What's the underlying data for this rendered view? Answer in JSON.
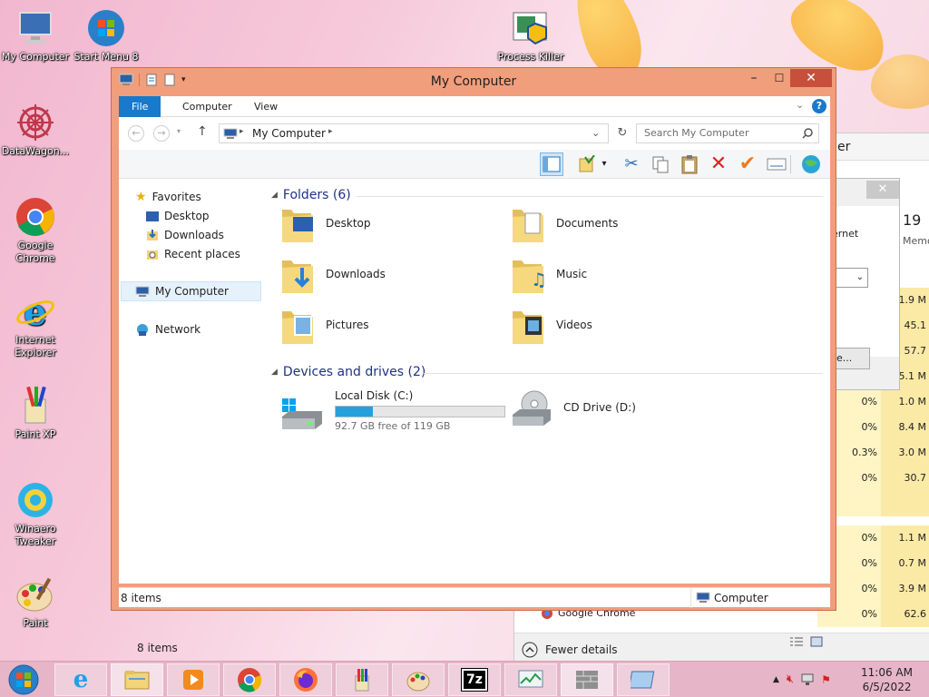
{
  "desktop": {
    "icons": [
      {
        "label": "My Computer"
      },
      {
        "label": "Start Menu 8"
      },
      {
        "label": "Process Killer"
      },
      {
        "label": "DataWagon..."
      },
      {
        "label": "Google Chrome"
      },
      {
        "label": "Internet Explorer"
      },
      {
        "label": "Paint XP"
      },
      {
        "label": "Winaero Tweaker"
      },
      {
        "label": "Paint"
      }
    ]
  },
  "task_manager": {
    "header_count": "19",
    "header_label": "Memo",
    "partial_title": "er",
    "dialog_text": "ernet",
    "dialog_button": "e...",
    "rows": [
      {
        "cpu": "",
        "mem": "1.9 M"
      },
      {
        "cpu": "",
        "mem": "45.1"
      },
      {
        "cpu": "",
        "mem": "57.7"
      },
      {
        "cpu": "",
        "mem": "5.1 M"
      },
      {
        "cpu": "0%",
        "mem": "1.0 M"
      },
      {
        "cpu": "0%",
        "mem": "8.4 M"
      },
      {
        "cpu": "0.3%",
        "mem": "3.0 M"
      },
      {
        "cpu": "0%",
        "mem": "30.7"
      },
      {
        "cpu": "",
        "mem": ""
      },
      {
        "cpu": "0%",
        "mem": "1.1 M"
      },
      {
        "cpu": "0%",
        "mem": "0.7 M"
      },
      {
        "cpu": "0%",
        "mem": "3.9 M"
      },
      {
        "cpu": "0%",
        "mem": "62.6"
      }
    ],
    "chrome_row": "Google Chrome",
    "fewer_details": "Fewer details"
  },
  "explorer": {
    "title": "My Computer",
    "tabs": {
      "file": "File",
      "computer": "Computer",
      "view": "View"
    },
    "address": "My Computer",
    "search_placeholder": "Search My Computer",
    "nav": {
      "favorites": "Favorites",
      "desktop": "Desktop",
      "downloads": "Downloads",
      "recent": "Recent places",
      "computer": "My Computer",
      "network": "Network"
    },
    "folders_header": "Folders (6)",
    "folders": [
      {
        "name": "Desktop"
      },
      {
        "name": "Documents"
      },
      {
        "name": "Downloads"
      },
      {
        "name": "Music"
      },
      {
        "name": "Pictures"
      },
      {
        "name": "Videos"
      }
    ],
    "drives_header": "Devices and drives (2)",
    "drives": {
      "local": {
        "name": "Local Disk (C:)",
        "free": "92.7 GB free of 119 GB",
        "used_fraction": 0.221
      },
      "cd": {
        "name": "CD Drive (D:)"
      }
    },
    "items_count": "8 items",
    "status_left": "8 items",
    "status_right": "Computer"
  },
  "taskbar": {
    "time": "11:06 AM",
    "date": "6/5/2022"
  },
  "colors": {
    "accent": "#1979ca",
    "window_frame": "#f09e7c",
    "close": "#c7503d"
  }
}
